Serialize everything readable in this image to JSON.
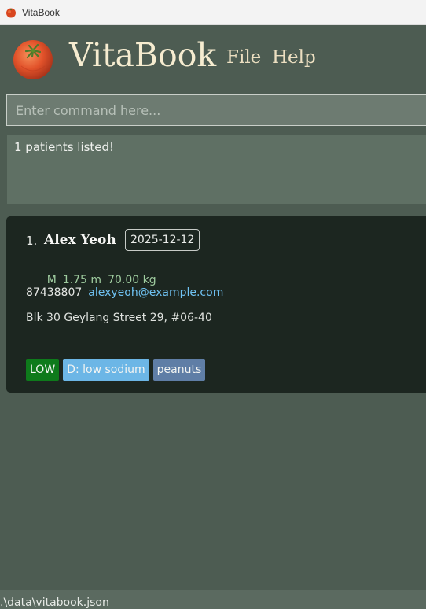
{
  "window": {
    "title": "VitaBook"
  },
  "header": {
    "app_title": "VitaBook",
    "menu": {
      "file": "File",
      "help": "Help"
    }
  },
  "command": {
    "placeholder": "Enter command here...",
    "value": ""
  },
  "result": {
    "message": "1 patients listed!"
  },
  "patients": [
    {
      "index": "1.",
      "name": "Alex Yeoh",
      "date": "2025-12-12",
      "gender": "M",
      "height": "1.75 m",
      "weight": "70.00 kg",
      "phone": "87438807",
      "email": "alexyeoh@example.com",
      "address": "Blk 30 Geylang Street 29, #06-40",
      "tags": {
        "risk": "LOW",
        "diet": "D: low sodium",
        "allergy": "peanuts"
      }
    }
  ],
  "status": {
    "file_path": ".\\data\\vitabook.json"
  },
  "colors": {
    "background": "#4d5c52",
    "card": "#1c2620",
    "risk_low": "#0e7a1b",
    "diet": "#6cb6e6",
    "allergy": "#5f7ea6",
    "email": "#6fc2f2",
    "vitals": "#9fcc9f"
  },
  "icons": {
    "app_icon": "tomato-icon",
    "logo": "tomato-logo"
  }
}
